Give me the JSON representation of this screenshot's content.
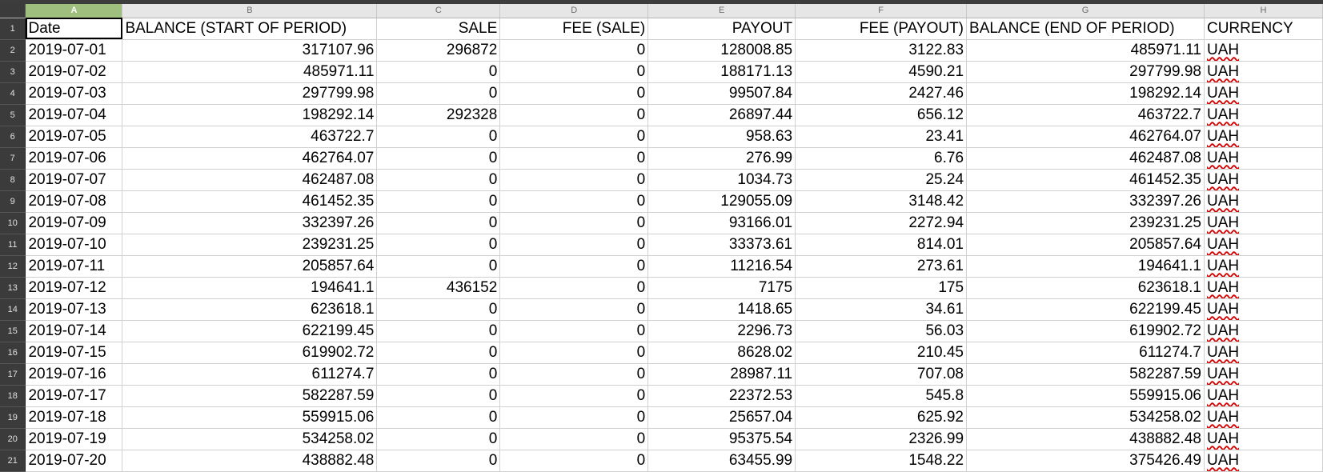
{
  "columns": [
    "A",
    "B",
    "C",
    "D",
    "E",
    "F",
    "G",
    "H"
  ],
  "selected_cell": "A1",
  "header_row": {
    "row_number": "1",
    "cells": [
      "Date",
      "BALANCE (START OF PERIOD)",
      "SALE",
      "FEE (SALE)",
      "PAYOUT",
      "FEE (PAYOUT)",
      "BALANCE (END OF PERIOD)",
      "CURRENCY"
    ]
  },
  "rows": [
    {
      "n": "2",
      "date": "2019-07-01",
      "start": "317107.96",
      "sale": "296872",
      "fee_sale": "0",
      "payout": "128008.85",
      "fee_payout": "3122.83",
      "end": "485971.11",
      "currency": "UAH"
    },
    {
      "n": "3",
      "date": "2019-07-02",
      "start": "485971.11",
      "sale": "0",
      "fee_sale": "0",
      "payout": "188171.13",
      "fee_payout": "4590.21",
      "end": "297799.98",
      "currency": "UAH"
    },
    {
      "n": "4",
      "date": "2019-07-03",
      "start": "297799.98",
      "sale": "0",
      "fee_sale": "0",
      "payout": "99507.84",
      "fee_payout": "2427.46",
      "end": "198292.14",
      "currency": "UAH"
    },
    {
      "n": "5",
      "date": "2019-07-04",
      "start": "198292.14",
      "sale": "292328",
      "fee_sale": "0",
      "payout": "26897.44",
      "fee_payout": "656.12",
      "end": "463722.7",
      "currency": "UAH"
    },
    {
      "n": "6",
      "date": "2019-07-05",
      "start": "463722.7",
      "sale": "0",
      "fee_sale": "0",
      "payout": "958.63",
      "fee_payout": "23.41",
      "end": "462764.07",
      "currency": "UAH"
    },
    {
      "n": "7",
      "date": "2019-07-06",
      "start": "462764.07",
      "sale": "0",
      "fee_sale": "0",
      "payout": "276.99",
      "fee_payout": "6.76",
      "end": "462487.08",
      "currency": "UAH"
    },
    {
      "n": "8",
      "date": "2019-07-07",
      "start": "462487.08",
      "sale": "0",
      "fee_sale": "0",
      "payout": "1034.73",
      "fee_payout": "25.24",
      "end": "461452.35",
      "currency": "UAH"
    },
    {
      "n": "9",
      "date": "2019-07-08",
      "start": "461452.35",
      "sale": "0",
      "fee_sale": "0",
      "payout": "129055.09",
      "fee_payout": "3148.42",
      "end": "332397.26",
      "currency": "UAH"
    },
    {
      "n": "10",
      "date": "2019-07-09",
      "start": "332397.26",
      "sale": "0",
      "fee_sale": "0",
      "payout": "93166.01",
      "fee_payout": "2272.94",
      "end": "239231.25",
      "currency": "UAH"
    },
    {
      "n": "11",
      "date": "2019-07-10",
      "start": "239231.25",
      "sale": "0",
      "fee_sale": "0",
      "payout": "33373.61",
      "fee_payout": "814.01",
      "end": "205857.64",
      "currency": "UAH"
    },
    {
      "n": "12",
      "date": "2019-07-11",
      "start": "205857.64",
      "sale": "0",
      "fee_sale": "0",
      "payout": "11216.54",
      "fee_payout": "273.61",
      "end": "194641.1",
      "currency": "UAH"
    },
    {
      "n": "13",
      "date": "2019-07-12",
      "start": "194641.1",
      "sale": "436152",
      "fee_sale": "0",
      "payout": "7175",
      "fee_payout": "175",
      "end": "623618.1",
      "currency": "UAH"
    },
    {
      "n": "14",
      "date": "2019-07-13",
      "start": "623618.1",
      "sale": "0",
      "fee_sale": "0",
      "payout": "1418.65",
      "fee_payout": "34.61",
      "end": "622199.45",
      "currency": "UAH"
    },
    {
      "n": "15",
      "date": "2019-07-14",
      "start": "622199.45",
      "sale": "0",
      "fee_sale": "0",
      "payout": "2296.73",
      "fee_payout": "56.03",
      "end": "619902.72",
      "currency": "UAH"
    },
    {
      "n": "16",
      "date": "2019-07-15",
      "start": "619902.72",
      "sale": "0",
      "fee_sale": "0",
      "payout": "8628.02",
      "fee_payout": "210.45",
      "end": "611274.7",
      "currency": "UAH"
    },
    {
      "n": "17",
      "date": "2019-07-16",
      "start": "611274.7",
      "sale": "0",
      "fee_sale": "0",
      "payout": "28987.11",
      "fee_payout": "707.08",
      "end": "582287.59",
      "currency": "UAH"
    },
    {
      "n": "18",
      "date": "2019-07-17",
      "start": "582287.59",
      "sale": "0",
      "fee_sale": "0",
      "payout": "22372.53",
      "fee_payout": "545.8",
      "end": "559915.06",
      "currency": "UAH"
    },
    {
      "n": "19",
      "date": "2019-07-18",
      "start": "559915.06",
      "sale": "0",
      "fee_sale": "0",
      "payout": "25657.04",
      "fee_payout": "625.92",
      "end": "534258.02",
      "currency": "UAH"
    },
    {
      "n": "20",
      "date": "2019-07-19",
      "start": "534258.02",
      "sale": "0",
      "fee_sale": "0",
      "payout": "95375.54",
      "fee_payout": "2326.99",
      "end": "438882.48",
      "currency": "UAH"
    },
    {
      "n": "21",
      "date": "2019-07-20",
      "start": "438882.48",
      "sale": "0",
      "fee_sale": "0",
      "payout": "63455.99",
      "fee_payout": "1548.22",
      "end": "375426.49",
      "currency": "UAH"
    }
  ]
}
